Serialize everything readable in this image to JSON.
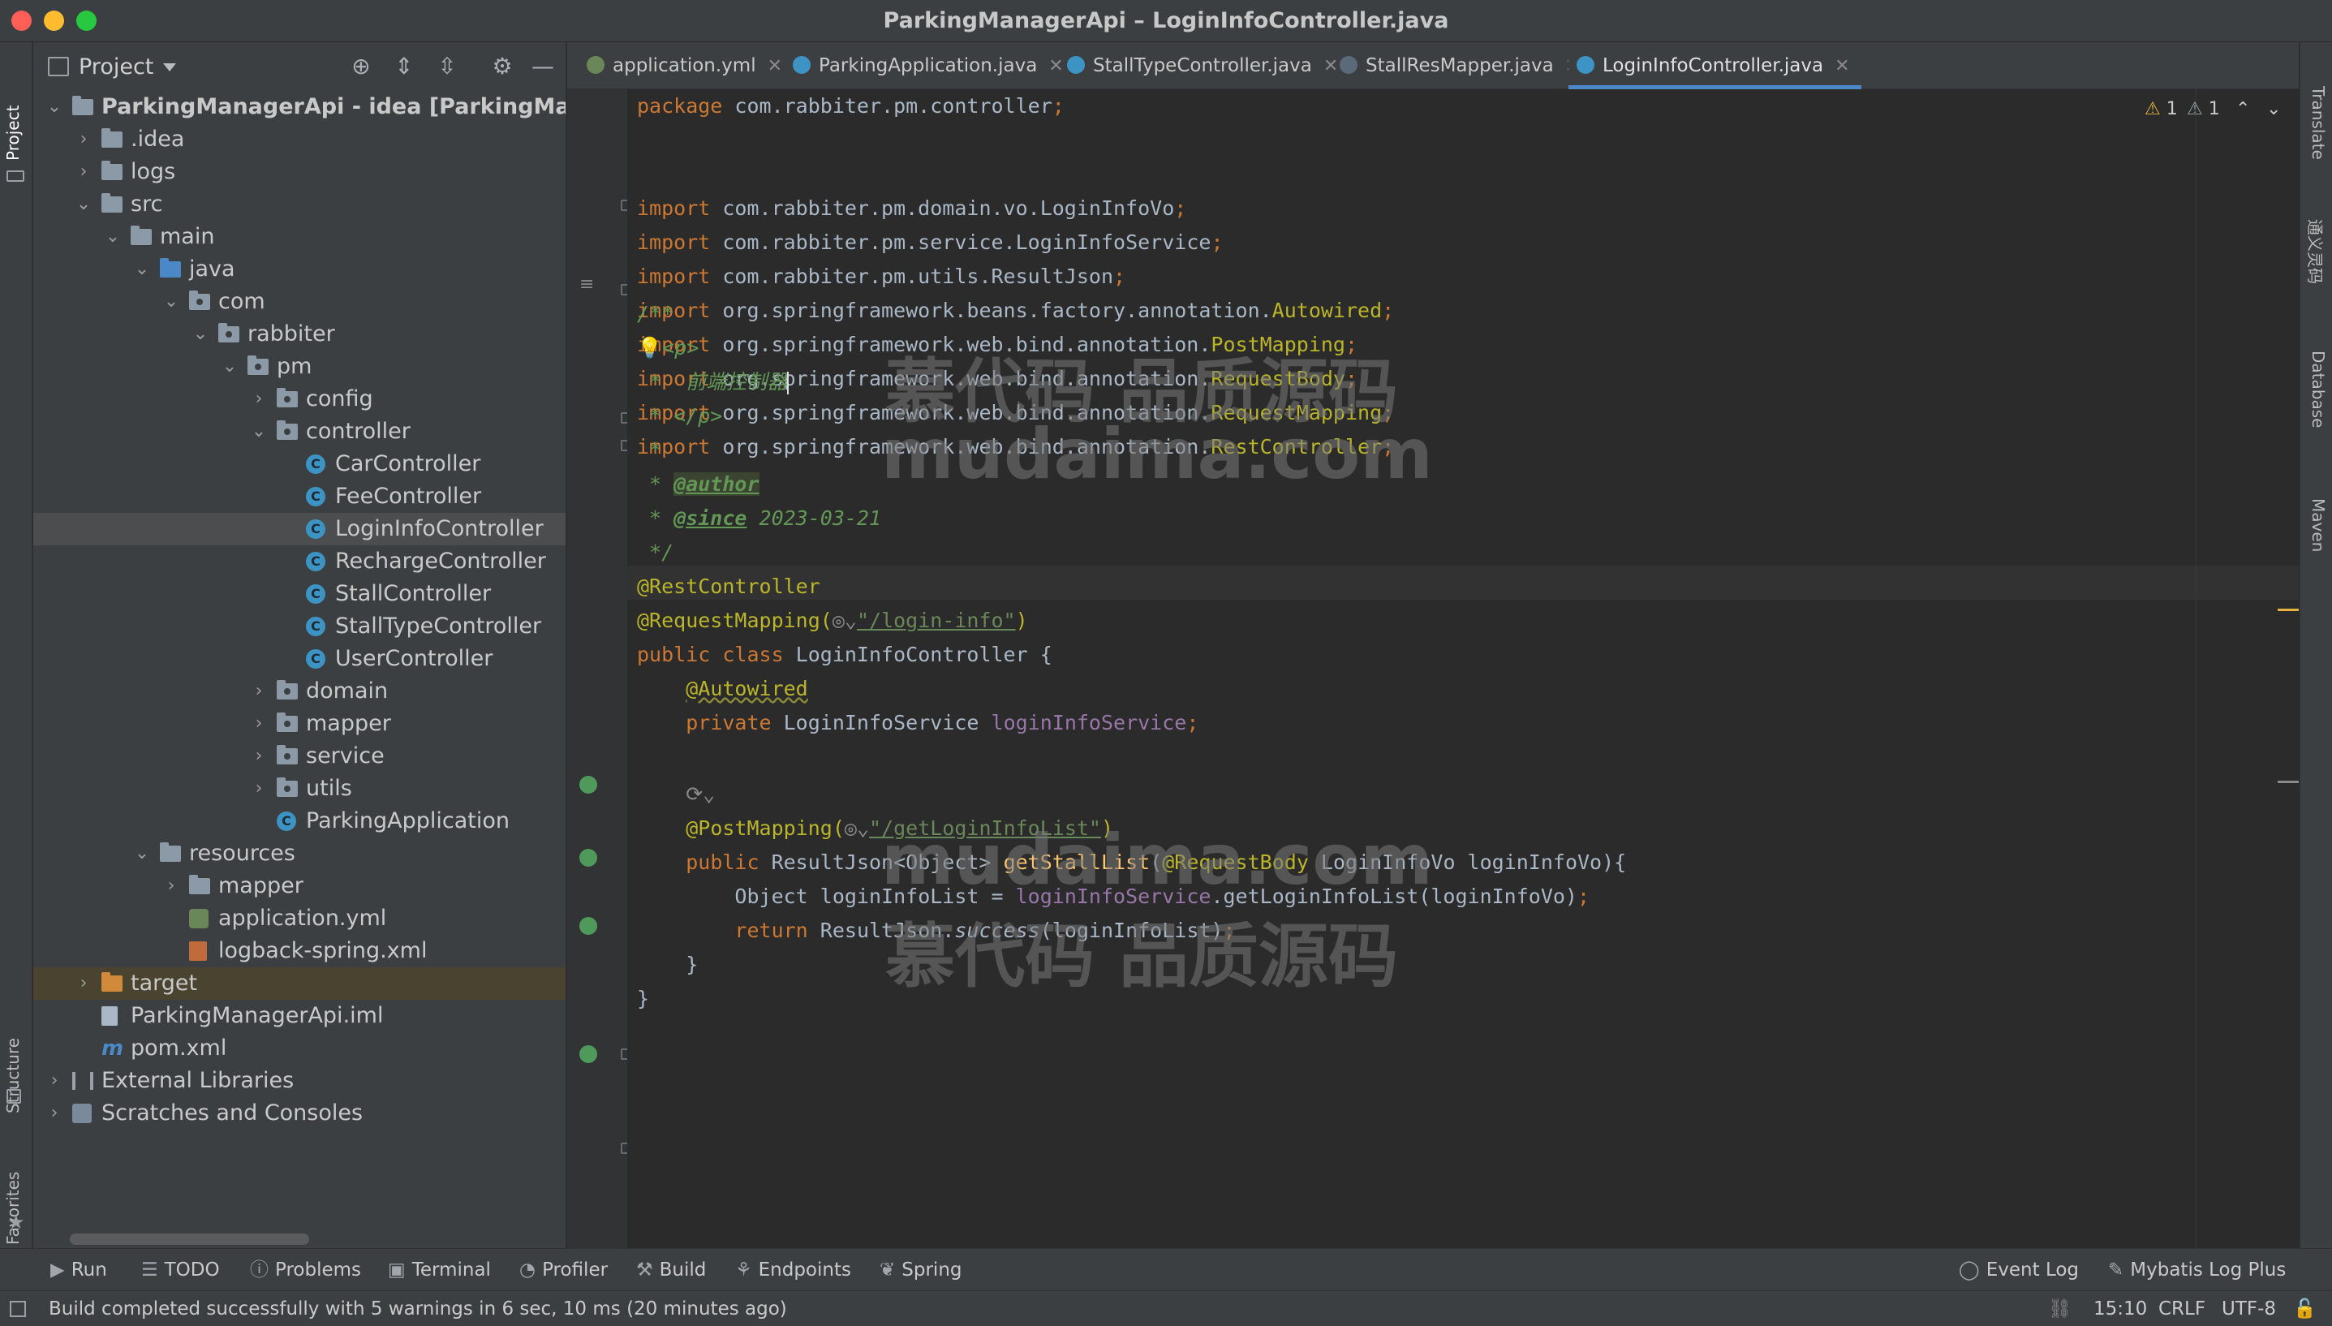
{
  "window": {
    "title": "ParkingManagerApi – LoginInfoController.java"
  },
  "left_strip": {
    "project": "Project",
    "structure": "Structure",
    "favorites": "Favorites"
  },
  "project_panel": {
    "title": "Project",
    "tree": [
      {
        "label": "ParkingManagerApi - idea [ParkingManagerA",
        "icon": "folder-icon",
        "depth": 0,
        "expanded": true,
        "bold": true
      },
      {
        "label": ".idea",
        "icon": "folder-icon",
        "depth": 1,
        "expanded": false
      },
      {
        "label": "logs",
        "icon": "folder-icon",
        "depth": 1,
        "expanded": false
      },
      {
        "label": "src",
        "icon": "folder-icon",
        "depth": 1,
        "expanded": true
      },
      {
        "label": "main",
        "icon": "folder-icon",
        "depth": 2,
        "expanded": true
      },
      {
        "label": "java",
        "icon": "source-folder-icon",
        "depth": 3,
        "expanded": true
      },
      {
        "label": "com",
        "icon": "package-icon",
        "depth": 4,
        "expanded": true
      },
      {
        "label": "rabbiter",
        "icon": "package-icon",
        "depth": 5,
        "expanded": true
      },
      {
        "label": "pm",
        "icon": "package-icon",
        "depth": 6,
        "expanded": true
      },
      {
        "label": "config",
        "icon": "package-icon",
        "depth": 7,
        "expanded": false
      },
      {
        "label": "controller",
        "icon": "package-icon",
        "depth": 7,
        "expanded": true
      },
      {
        "label": "CarController",
        "icon": "class-icon",
        "depth": 8
      },
      {
        "label": "FeeController",
        "icon": "class-icon",
        "depth": 8
      },
      {
        "label": "LoginInfoController",
        "icon": "class-icon",
        "depth": 8
      },
      {
        "label": "RechargeController",
        "icon": "class-icon",
        "depth": 8
      },
      {
        "label": "StallController",
        "icon": "class-icon",
        "depth": 8
      },
      {
        "label": "StallTypeController",
        "icon": "class-icon",
        "depth": 8
      },
      {
        "label": "UserController",
        "icon": "class-icon",
        "depth": 8
      },
      {
        "label": "domain",
        "icon": "package-icon",
        "depth": 7,
        "expanded": false
      },
      {
        "label": "mapper",
        "icon": "package-icon",
        "depth": 7,
        "expanded": false
      },
      {
        "label": "service",
        "icon": "package-icon",
        "depth": 7,
        "expanded": false
      },
      {
        "label": "utils",
        "icon": "package-icon",
        "depth": 7,
        "expanded": false
      },
      {
        "label": "ParkingApplication",
        "icon": "spring-class-icon",
        "depth": 7
      },
      {
        "label": "resources",
        "icon": "resources-folder-icon",
        "depth": 3,
        "expanded": true
      },
      {
        "label": "mapper",
        "icon": "folder-icon",
        "depth": 4,
        "expanded": false
      },
      {
        "label": "application.yml",
        "icon": "yml-file-icon",
        "depth": 4
      },
      {
        "label": "logback-spring.xml",
        "icon": "xml-file-icon",
        "depth": 4
      },
      {
        "label": "target",
        "icon": "excluded-folder-icon",
        "depth": 1,
        "expanded": false,
        "highlight": true
      },
      {
        "label": "ParkingManagerApi.iml",
        "icon": "iml-file-icon",
        "depth": 1
      },
      {
        "label": "pom.xml",
        "icon": "maven-file-icon",
        "depth": 1
      },
      {
        "label": "External Libraries",
        "icon": "libraries-icon",
        "depth": 0,
        "expanded": false
      },
      {
        "label": "Scratches and Consoles",
        "icon": "scratches-icon",
        "depth": 0,
        "expanded": false
      }
    ]
  },
  "tabs": [
    {
      "label": "application.yml",
      "icon": "yml-file-icon",
      "color": "#6a8759"
    },
    {
      "label": "ParkingApplication.java",
      "icon": "spring-class-icon",
      "color": "#3d94c4"
    },
    {
      "label": "StallTypeController.java",
      "icon": "class-icon",
      "color": "#3d94c4"
    },
    {
      "label": "StallResMapper.java",
      "icon": "mapper-icon",
      "color": "#5a6a7a"
    },
    {
      "label": "LoginInfoController.java",
      "icon": "class-icon",
      "color": "#3d94c4",
      "active": true
    }
  ],
  "inspections": {
    "warnings": "1",
    "weak_warnings": "1"
  },
  "code": {
    "package_kw": "package",
    "package_name": " com.rabbiter.pm.controller",
    "import_kw": "import",
    "imports": [
      {
        "path": " com.rabbiter.pm.domain.vo.",
        "last": "LoginInfoVo",
        "last_class": ""
      },
      {
        "path": " com.rabbiter.pm.service.",
        "last": "LoginInfoService",
        "last_class": ""
      },
      {
        "path": " com.rabbiter.pm.utils.",
        "last": "ResultJson",
        "last_class": ""
      },
      {
        "path": " org.springframework.beans.factory.annotation.",
        "last": "Autowired",
        "last_class": "ann"
      },
      {
        "path": " org.springframework.web.bind.annotation.",
        "last": "PostMapping",
        "last_class": "ann"
      },
      {
        "path": " org.springframework.web.bind.annotation.",
        "last": "RequestBody",
        "last_class": "ann"
      },
      {
        "path": " org.springframework.web.bind.annotation.",
        "last": "RequestMapping",
        "last_class": "ann"
      },
      {
        "path": " org.springframework.web.bind.annotation.",
        "last": "RestController",
        "last_class": "ann"
      }
    ],
    "doc_open": "/**",
    "doc_p_open": "<p>",
    "doc_desc": " *  前端控制器",
    "doc_p_close": " * </p>",
    "doc_star": " *",
    "doc_star_prefix": " * ",
    "author_tag": "@author",
    "since_tag": "@since",
    "since_value": " 2023-03-21",
    "doc_close": " */",
    "rest_controller": "@RestController",
    "request_mapping": "@RequestMapping(",
    "request_mapping_value": "\"/login-info\"",
    "close_paren": ")",
    "class_kw": "public class",
    "class_name": " LoginInfoController {",
    "autowired": "@Autowired",
    "private_kw": "private",
    "field_type": " LoginInfoService ",
    "field_name": "loginInfoService",
    "post_mapping": "@PostMapping(",
    "post_mapping_value": "\"/getLoginInfoList\"",
    "method_kw": "public",
    "return_type": " ResultJson<Object> ",
    "method_name": "getStallList",
    "request_body": "@RequestBody",
    "params": " LoginInfoVo loginInfoVo){",
    "body_line_type": "Object loginInfoList = ",
    "body_line_call": ".getLoginInfoList(loginInfoVo)",
    "return_kw": "return",
    "return_expr_a": " ResultJson.",
    "return_expr_b": "success",
    "return_expr_c": "(loginInfoList)",
    "semicolon": ";",
    "close_brace_inner": "}",
    "close_brace_outer": "}"
  },
  "watermarks": [
    "慕代码 品质源码",
    "mudaima.com",
    "mudaima.com",
    "慕代码 品质源码"
  ],
  "right_strip": {
    "translate": "Translate",
    "tongyi": "通义灵码",
    "database": "Database",
    "maven": "Maven"
  },
  "bottom_tools": {
    "left": [
      {
        "label": "Run",
        "icon": "run-icon"
      },
      {
        "label": "TODO",
        "icon": "todo-icon"
      },
      {
        "label": "Problems",
        "icon": "problems-icon"
      },
      {
        "label": "Terminal",
        "icon": "terminal-icon"
      },
      {
        "label": "Profiler",
        "icon": "profiler-icon"
      },
      {
        "label": "Build",
        "icon": "build-icon"
      },
      {
        "label": "Endpoints",
        "icon": "endpoints-icon"
      },
      {
        "label": "Spring",
        "icon": "spring-icon"
      }
    ],
    "right": [
      {
        "label": "Event Log",
        "icon": "event-log-icon"
      },
      {
        "label": "Mybatis Log Plus",
        "icon": "mybatis-icon"
      }
    ]
  },
  "status": {
    "message": "Build completed successfully with 5 warnings in 6 sec, 10 ms (20 minutes ago)",
    "position": "15:10",
    "line_separator": "CRLF",
    "encoding": "UTF-8"
  }
}
